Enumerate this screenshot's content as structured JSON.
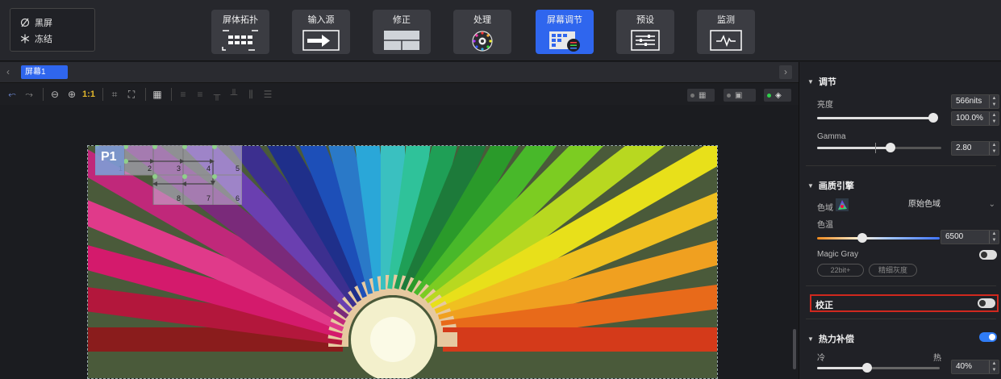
{
  "top": {
    "blackout_label": "黑屏",
    "freeze_label": "冻结",
    "tools": [
      {
        "label": "屏体拓扑",
        "icon": "topology-grid-icon"
      },
      {
        "label": "输入源",
        "icon": "input-arrow-icon"
      },
      {
        "label": "修正",
        "icon": "correction-panels-icon"
      },
      {
        "label": "处理",
        "icon": "processing-dial-icon"
      },
      {
        "label": "屏幕调节",
        "icon": "screen-adjust-icon"
      },
      {
        "label": "预设",
        "icon": "preset-sliders-icon"
      },
      {
        "label": "监测",
        "icon": "monitor-wave-icon"
      }
    ],
    "active_tool": "屏幕调节",
    "accent": "#2f66ee"
  },
  "tabs": {
    "screen1": "屏幕1"
  },
  "toolbar": {
    "zoom_reset": "1:1"
  },
  "mapping": {
    "receiver_label": "P1",
    "cells": [
      "1",
      "2",
      "3",
      "4",
      "5",
      "8",
      "7",
      "6"
    ]
  },
  "sidebar": {
    "adjust": {
      "title": "调节",
      "brightness_label": "亮度",
      "brightness_nits": "566nits",
      "brightness_pct": "100.0%",
      "brightness_level": 1.0,
      "gamma_label": "Gamma",
      "gamma_value": "2.80"
    },
    "engine": {
      "title": "画质引擎",
      "gamut_label": "色域",
      "gamut_value": "原始色域",
      "temp_label": "色温",
      "temp_value": "6500",
      "magic_gray_label": "Magic Gray",
      "magic_gray_on": false,
      "chip1": "22bit+",
      "chip2": "精细灰度"
    },
    "calibration": {
      "label": "校正",
      "on": false
    },
    "thermal": {
      "title": "热力补偿",
      "on": true,
      "cold_label": "冷",
      "hot_label": "热",
      "value": "40%"
    }
  }
}
